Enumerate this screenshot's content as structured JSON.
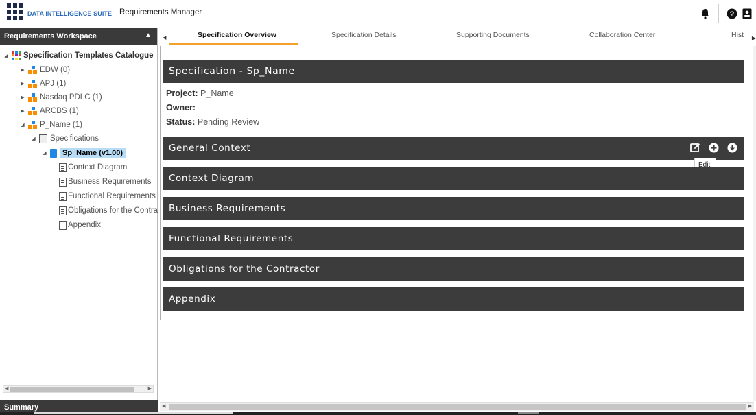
{
  "header": {
    "brand": "DATA INTELLIGENCE SUITE",
    "module": "Requirements Manager"
  },
  "sidebar": {
    "title": "Requirements Workspace",
    "footer": "Summary",
    "tree": {
      "root": "Specification Templates Catalogue",
      "projects": [
        {
          "label": "EDW (0)"
        },
        {
          "label": "APJ (1)"
        },
        {
          "label": "Nasdaq PDLC (1)"
        },
        {
          "label": "ARCBS (1)"
        },
        {
          "label": "P_Name (1)"
        }
      ],
      "folder": "Specifications",
      "selected": "Sp_Name (v1.00)",
      "sections": [
        {
          "label": "Context Diagram"
        },
        {
          "label": "Business Requirements"
        },
        {
          "label": "Functional Requirements"
        },
        {
          "label": "Obligations for the Contra"
        },
        {
          "label": "Appendix"
        }
      ]
    }
  },
  "tabs": [
    {
      "label": "Specification Overview",
      "active": true
    },
    {
      "label": "Specification Details"
    },
    {
      "label": "Supporting Documents"
    },
    {
      "label": "Collaboration Center"
    },
    {
      "label": "Hist"
    }
  ],
  "overview": {
    "title": "Specification - Sp_Name",
    "project_label": "Project:",
    "project_value": "P_Name",
    "owner_label": "Owner:",
    "owner_value": "",
    "status_label": "Status:",
    "status_value": "Pending Review",
    "sections": [
      {
        "label": "General Context"
      },
      {
        "label": "Context Diagram"
      },
      {
        "label": "Business Requirements"
      },
      {
        "label": "Functional Requirements"
      },
      {
        "label": "Obligations for the Contractor"
      },
      {
        "label": "Appendix"
      }
    ],
    "tooltip": "Edit"
  },
  "colors": {
    "accent": "#f3a12b",
    "bar_bg": "#3c3c3c",
    "selected_bg": "#b8dcf6",
    "brand": "#2a6ab8"
  }
}
